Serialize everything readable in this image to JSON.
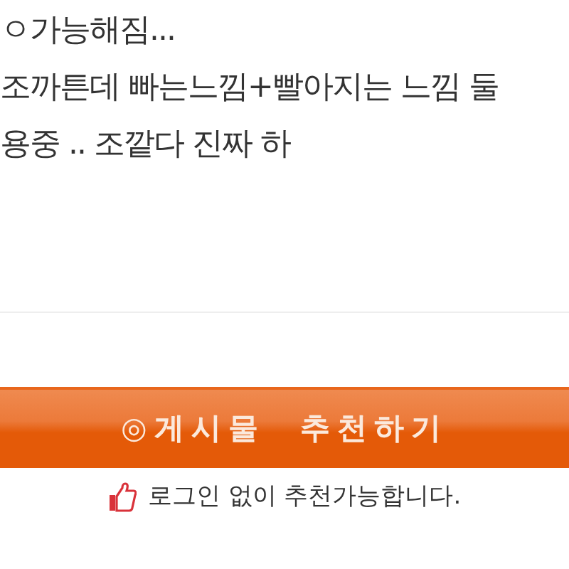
{
  "post_body": {
    "lines": [
      "ㅇ가능해짐...",
      "조까튼데 빠는느낌+빨아지는 느낌 둘",
      "용중 .. 조깥다 진짜 하"
    ]
  },
  "recommend_button": {
    "label": "◎게시물  추천하기"
  },
  "recommend_note": {
    "text": "로그인 없이 추천가능합니다."
  }
}
